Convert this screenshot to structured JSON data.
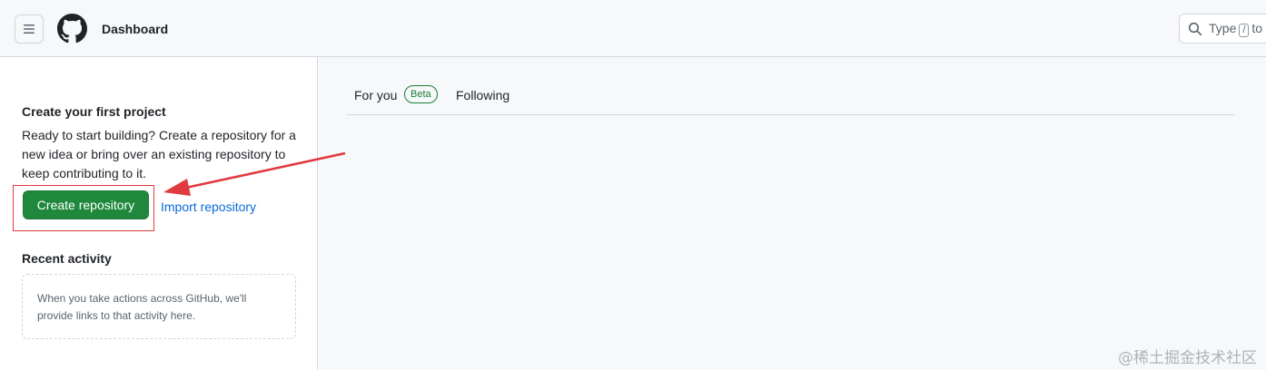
{
  "header": {
    "title": "Dashboard",
    "search_prefix": "Type",
    "search_key": "/",
    "search_suffix": "to"
  },
  "sidebar": {
    "project_heading": "Create your first project",
    "project_description": "Ready to start building? Create a repository for a new idea or bring over an existing repository to keep contributing to it.",
    "create_button": "Create repository",
    "import_link": "Import repository",
    "activity_heading": "Recent activity",
    "activity_empty": "When you take actions across GitHub, we'll provide links to that activity here."
  },
  "main": {
    "tabs": [
      {
        "label": "For you",
        "badge": "Beta"
      },
      {
        "label": "Following"
      }
    ]
  },
  "watermark": "@稀土掘金技术社区",
  "colors": {
    "primary_button": "#1f883d",
    "link": "#0969da",
    "annotation": "#e0393e",
    "beta": "#1a7f37"
  }
}
